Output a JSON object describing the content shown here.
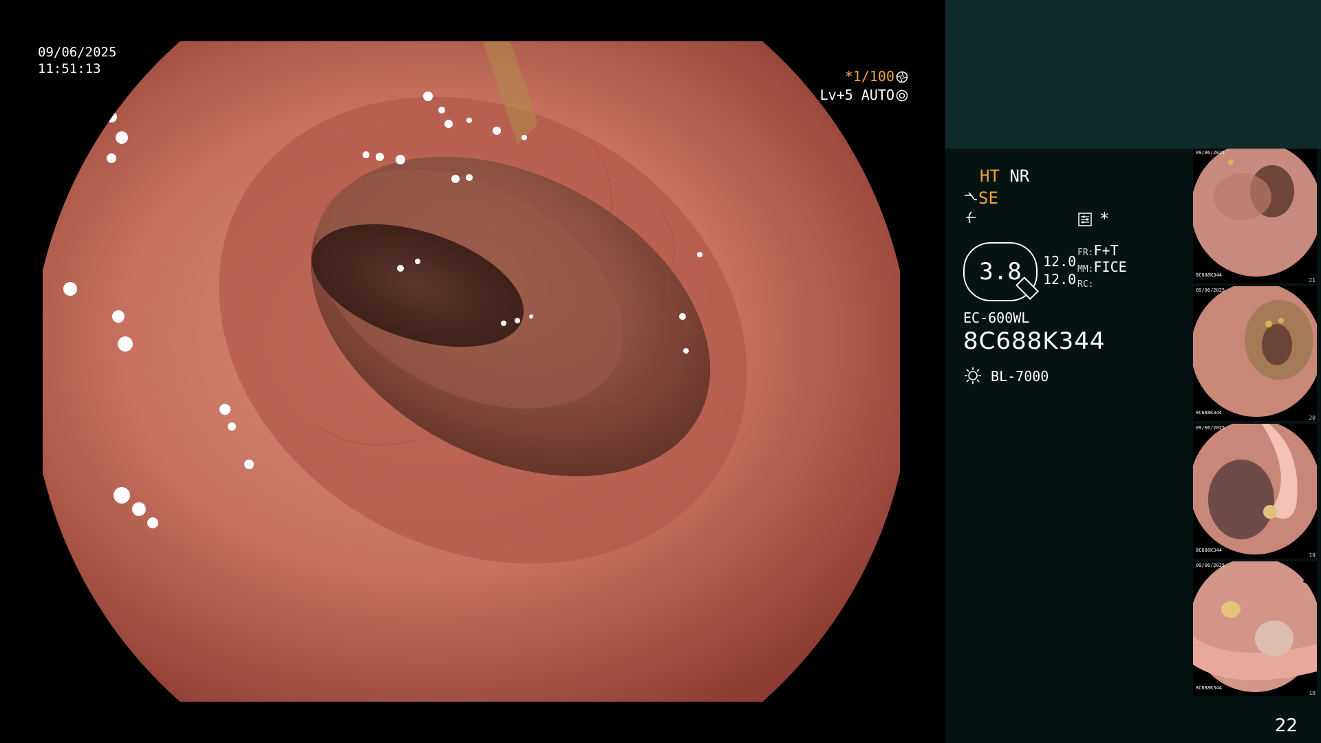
{
  "osd": {
    "date": "09/06/2025",
    "time": "11:51:13",
    "shutter": "*1/100",
    "shutter_icon": "aperture-icon",
    "level": "Lv+5 AUTO",
    "level_icon": "iris-icon"
  },
  "panel": {
    "ht": "HT",
    "nr": "NR",
    "se": "SE",
    "se_icon": "enhance-icon",
    "f_icon": "structure-icon",
    "menu_icon": "settings-panel-icon",
    "star": "*",
    "zoom": "3.8",
    "zoom_values": [
      "12.0",
      "12.0"
    ],
    "fr_label": "FR:",
    "fr_value": "F+T",
    "mm_label": "MM:",
    "mm_value": "FICE",
    "rc_label": "RC:",
    "scope_model": "EC-600WL",
    "serial": "8C688K344",
    "light_source": "BL-7000",
    "light_icon": "lamp-icon"
  },
  "thumbnails": [
    {
      "caption_top": "09/06/2025",
      "caption_serial": "8C688K344",
      "number": "21"
    },
    {
      "caption_top": "09/06/2025",
      "caption_serial": "8C688K344",
      "number": "20"
    },
    {
      "caption_top": "09/06/2025",
      "caption_serial": "8C688K344",
      "number": "19"
    },
    {
      "caption_top": "09/06/2025",
      "caption_serial": "8C688K344",
      "number": "18"
    }
  ],
  "page_number": "22",
  "colors": {
    "orange": "#f0a33a",
    "panel_bg": "#061313",
    "panel_top_bg": "#0e2a2a",
    "mucosa": "#c26a5c"
  }
}
